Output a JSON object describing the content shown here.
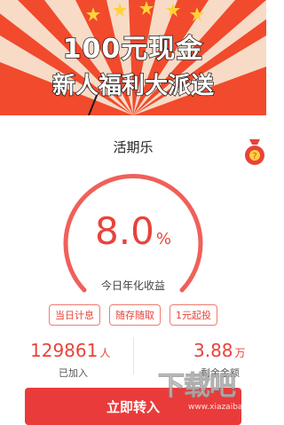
{
  "banner": {
    "headline_1": "100元现金",
    "headline_2": "新人福利大派送"
  },
  "product": {
    "name": "活期乐",
    "rate_value": "8.0",
    "rate_unit": "%",
    "rate_label": "今日年化收益"
  },
  "tags": [
    "当日计息",
    "随存随取",
    "1元起投"
  ],
  "stats": {
    "joined_value": "129861",
    "joined_unit": "人",
    "joined_label": "已加入",
    "remaining_value": "3.88",
    "remaining_unit": "万",
    "remaining_label": "剩余金额"
  },
  "cta": {
    "label": "立即转入"
  },
  "watermark": {
    "text": "下载吧",
    "sub": "www.xiazaiba.com"
  },
  "colors": {
    "accent": "#e8433b",
    "banner_red": "#f14a2c",
    "stripe_cream": "#f8e3d0",
    "star_gold": "#ffd23a"
  }
}
